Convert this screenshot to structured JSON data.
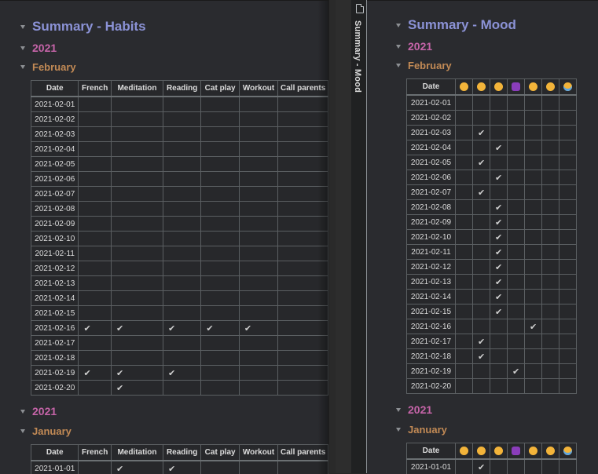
{
  "tab": {
    "title": "Summary - Mood",
    "icon": "file-icon"
  },
  "habits": {
    "title": "Summary - Habits",
    "columns": [
      "Date",
      "French",
      "Meditation",
      "Reading",
      "Cat play",
      "Workout",
      "Call parents"
    ],
    "sections": [
      {
        "year": "2021",
        "month": "February",
        "rows": [
          {
            "date": "2021-02-01",
            "checks": [
              "",
              "",
              "",
              "",
              "",
              ""
            ]
          },
          {
            "date": "2021-02-02",
            "checks": [
              "",
              "",
              "",
              "",
              "",
              ""
            ]
          },
          {
            "date": "2021-02-03",
            "checks": [
              "",
              "",
              "",
              "",
              "",
              ""
            ]
          },
          {
            "date": "2021-02-04",
            "checks": [
              "",
              "",
              "",
              "",
              "",
              ""
            ]
          },
          {
            "date": "2021-02-05",
            "checks": [
              "",
              "",
              "",
              "",
              "",
              ""
            ]
          },
          {
            "date": "2021-02-06",
            "checks": [
              "",
              "",
              "",
              "",
              "",
              ""
            ]
          },
          {
            "date": "2021-02-07",
            "checks": [
              "",
              "",
              "",
              "",
              "",
              ""
            ]
          },
          {
            "date": "2021-02-08",
            "checks": [
              "",
              "",
              "",
              "",
              "",
              ""
            ]
          },
          {
            "date": "2021-02-09",
            "checks": [
              "",
              "",
              "",
              "",
              "",
              ""
            ]
          },
          {
            "date": "2021-02-10",
            "checks": [
              "",
              "",
              "",
              "",
              "",
              ""
            ]
          },
          {
            "date": "2021-02-11",
            "checks": [
              "",
              "",
              "",
              "",
              "",
              ""
            ]
          },
          {
            "date": "2021-02-12",
            "checks": [
              "",
              "",
              "",
              "",
              "",
              ""
            ]
          },
          {
            "date": "2021-02-13",
            "checks": [
              "",
              "",
              "",
              "",
              "",
              ""
            ]
          },
          {
            "date": "2021-02-14",
            "checks": [
              "",
              "",
              "",
              "",
              "",
              ""
            ]
          },
          {
            "date": "2021-02-15",
            "checks": [
              "",
              "",
              "",
              "",
              "",
              ""
            ]
          },
          {
            "date": "2021-02-16",
            "checks": [
              "✔",
              "✔",
              "✔",
              "✔",
              "✔",
              ""
            ]
          },
          {
            "date": "2021-02-17",
            "checks": [
              "",
              "",
              "",
              "",
              "",
              ""
            ]
          },
          {
            "date": "2021-02-18",
            "checks": [
              "",
              "",
              "",
              "",
              "",
              ""
            ]
          },
          {
            "date": "2021-02-19",
            "checks": [
              "✔",
              "✔",
              "✔",
              "",
              "",
              ""
            ]
          },
          {
            "date": "2021-02-20",
            "checks": [
              "",
              "✔",
              "",
              "",
              "",
              ""
            ]
          }
        ]
      },
      {
        "year": "2021",
        "month": "January",
        "rows": [
          {
            "date": "2021-01-01",
            "checks": [
              "",
              "✔",
              "✔",
              "",
              "",
              ""
            ]
          }
        ]
      }
    ]
  },
  "mood": {
    "title": "Summary - Mood",
    "columns": [
      "Date",
      "smiling-face-icon",
      "relieved-face-icon",
      "slightly-smiling-face-icon",
      "person-shrugging-icon",
      "neutral-face-icon",
      "upside-down-face-icon",
      "crying-face-icon"
    ],
    "sections": [
      {
        "year": "2021",
        "month": "February",
        "rows": [
          {
            "date": "2021-02-01",
            "checks": [
              "",
              "",
              "",
              "",
              "",
              "",
              ""
            ]
          },
          {
            "date": "2021-02-02",
            "checks": [
              "",
              "",
              "",
              "",
              "",
              "",
              ""
            ]
          },
          {
            "date": "2021-02-03",
            "checks": [
              "",
              "✔",
              "",
              "",
              "",
              "",
              ""
            ]
          },
          {
            "date": "2021-02-04",
            "checks": [
              "",
              "",
              "✔",
              "",
              "",
              "",
              ""
            ]
          },
          {
            "date": "2021-02-05",
            "checks": [
              "",
              "✔",
              "",
              "",
              "",
              "",
              ""
            ]
          },
          {
            "date": "2021-02-06",
            "checks": [
              "",
              "",
              "✔",
              "",
              "",
              "",
              ""
            ]
          },
          {
            "date": "2021-02-07",
            "checks": [
              "",
              "✔",
              "",
              "",
              "",
              "",
              ""
            ]
          },
          {
            "date": "2021-02-08",
            "checks": [
              "",
              "",
              "✔",
              "",
              "",
              "",
              ""
            ]
          },
          {
            "date": "2021-02-09",
            "checks": [
              "",
              "",
              "✔",
              "",
              "",
              "",
              ""
            ]
          },
          {
            "date": "2021-02-10",
            "checks": [
              "",
              "",
              "✔",
              "",
              "",
              "",
              ""
            ]
          },
          {
            "date": "2021-02-11",
            "checks": [
              "",
              "",
              "✔",
              "",
              "",
              "",
              ""
            ]
          },
          {
            "date": "2021-02-12",
            "checks": [
              "",
              "",
              "✔",
              "",
              "",
              "",
              ""
            ]
          },
          {
            "date": "2021-02-13",
            "checks": [
              "",
              "",
              "✔",
              "",
              "",
              "",
              ""
            ]
          },
          {
            "date": "2021-02-14",
            "checks": [
              "",
              "",
              "✔",
              "",
              "",
              "",
              ""
            ]
          },
          {
            "date": "2021-02-15",
            "checks": [
              "",
              "",
              "✔",
              "",
              "",
              "",
              ""
            ]
          },
          {
            "date": "2021-02-16",
            "checks": [
              "",
              "",
              "",
              "",
              "✔",
              "",
              ""
            ]
          },
          {
            "date": "2021-02-17",
            "checks": [
              "",
              "✔",
              "",
              "",
              "",
              "",
              ""
            ]
          },
          {
            "date": "2021-02-18",
            "checks": [
              "",
              "✔",
              "",
              "",
              "",
              "",
              ""
            ]
          },
          {
            "date": "2021-02-19",
            "checks": [
              "",
              "",
              "",
              "✔",
              "",
              "",
              ""
            ]
          },
          {
            "date": "2021-02-20",
            "checks": [
              "",
              "",
              "",
              "",
              "",
              "",
              ""
            ]
          }
        ]
      },
      {
        "year": "2021",
        "month": "January",
        "rows": [
          {
            "date": "2021-01-01",
            "checks": [
              "",
              "✔",
              "",
              "",
              "",
              "",
              ""
            ]
          }
        ]
      }
    ]
  },
  "colors": {
    "h1": "#8b92d6",
    "h2": "#c564a8",
    "h3": "#c28a55",
    "background": "#2a2b2f"
  }
}
